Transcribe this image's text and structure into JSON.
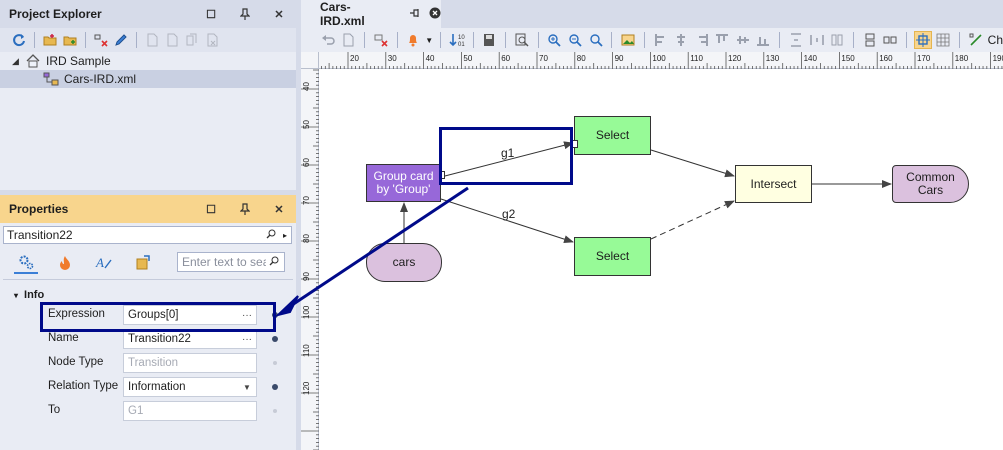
{
  "project_explorer": {
    "title": "Project Explorer",
    "tree": [
      {
        "label": "IRD Sample"
      },
      {
        "label": "Cars-IRD.xml"
      }
    ]
  },
  "properties": {
    "title": "Properties",
    "selected_object": "Transition22",
    "search_placeholder": "Enter text to search",
    "section": "Info",
    "rows": [
      {
        "label": "Expression",
        "value": "Groups[0]"
      },
      {
        "label": "Name",
        "value": "Transition22"
      },
      {
        "label": "Node Type",
        "value": "Transition"
      },
      {
        "label": "Relation Type",
        "value": "Information"
      },
      {
        "label": "To",
        "value": "G1"
      }
    ]
  },
  "document": {
    "tab_title": "Cars-IRD.xml",
    "toolbar_trailing_label": "Ch",
    "ruler_top": [
      "20",
      "30",
      "40",
      "50",
      "60",
      "70",
      "80",
      "90",
      "100",
      "110",
      "120",
      "130",
      "140",
      "150",
      "160",
      "170",
      "180",
      "190"
    ],
    "ruler_left": [
      "40",
      "50",
      "60",
      "70",
      "80",
      "90",
      "100",
      "110",
      "120"
    ]
  },
  "diagram": {
    "nodes": {
      "group": "Group card\nby 'Group'",
      "select1": "Select",
      "select2": "Select",
      "intersect": "Intersect",
      "common": "Common\nCars",
      "cars": "cars"
    },
    "edge_labels": {
      "g1": "g1",
      "g2": "g2"
    }
  },
  "colors": {
    "accent_highlight": "#000a8a",
    "group_node": "#9768d9",
    "select_node": "#97fa97",
    "intersect_node": "#ffffe1",
    "data_node": "#dbc1de",
    "properties_header": "#f8d58d"
  }
}
